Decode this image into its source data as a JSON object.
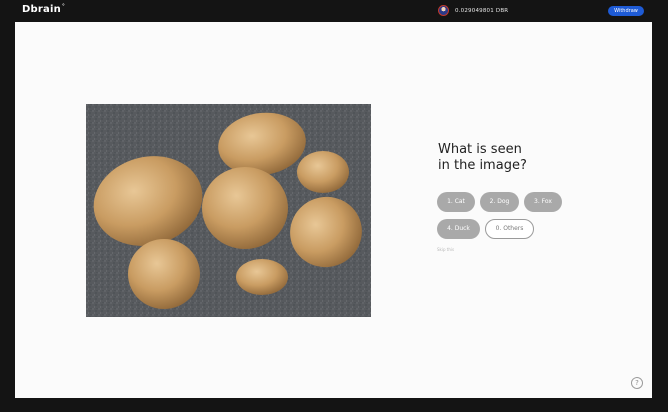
{
  "header": {
    "brand": "Dbrain",
    "brand_mark": "°",
    "balance": "0.029049801 DBR",
    "withdraw_label": "Withdraw"
  },
  "task": {
    "question_line1": "What is seen",
    "question_line2": "in the image?",
    "options": [
      {
        "label": "1. Cat"
      },
      {
        "label": "2. Dog"
      },
      {
        "label": "3. Fox"
      },
      {
        "label": "4. Duck"
      },
      {
        "label": "0. Others"
      }
    ],
    "skip_label": "Skip this"
  },
  "help": {
    "label": "?"
  },
  "image": {
    "subject": "potatoes-on-granite"
  },
  "colors": {
    "background": "#141414",
    "canvas": "#fbfbfb",
    "accent": "#1e5bd6",
    "option_fill": "#a9a9a9"
  }
}
